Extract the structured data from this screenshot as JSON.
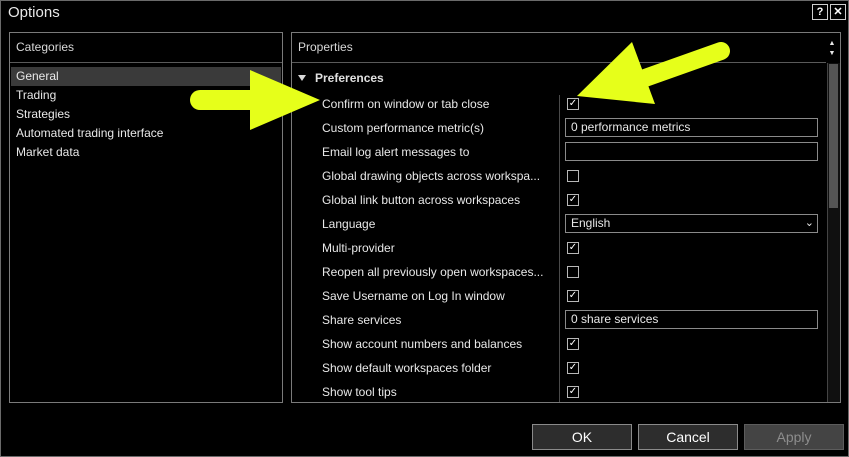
{
  "window": {
    "title": "Options",
    "help_label": "?",
    "close_label": "✕"
  },
  "categories": {
    "header": "Categories",
    "items": [
      "General",
      "Trading",
      "Strategies",
      "Automated trading interface",
      "Market data"
    ],
    "selected": "General"
  },
  "properties": {
    "header": "Properties",
    "group": "Preferences",
    "rows": [
      {
        "label": "Confirm on window or tab close",
        "type": "checkbox",
        "checked": true
      },
      {
        "label": "Custom performance metric(s)",
        "type": "field",
        "value": "0 performance metrics"
      },
      {
        "label": "Email log alert messages to",
        "type": "field",
        "value": ""
      },
      {
        "label": "Global drawing objects across workspa...",
        "type": "checkbox",
        "checked": false
      },
      {
        "label": "Global link button across workspaces",
        "type": "checkbox",
        "checked": true
      },
      {
        "label": "Language",
        "type": "select",
        "value": "English"
      },
      {
        "label": "Multi-provider",
        "type": "checkbox",
        "checked": true
      },
      {
        "label": "Reopen all previously open workspaces...",
        "type": "checkbox",
        "checked": false
      },
      {
        "label": "Save Username on Log In window",
        "type": "checkbox",
        "checked": true
      },
      {
        "label": "Share services",
        "type": "field",
        "value": "0 share services"
      },
      {
        "label": "Show account numbers and balances",
        "type": "checkbox",
        "checked": true
      },
      {
        "label": "Show default workspaces folder",
        "type": "checkbox",
        "checked": true
      },
      {
        "label": "Show tool tips",
        "type": "checkbox",
        "checked": true
      }
    ]
  },
  "buttons": {
    "ok": "OK",
    "cancel": "Cancel",
    "apply": "Apply"
  },
  "icons": {
    "checkmark": "check-icon",
    "dropdown": "chevron-down-icon",
    "expander": "triangle-down-icon"
  },
  "colors": {
    "background": "#000000",
    "border": "#7a7a7a",
    "annotation": "#e6ff1a"
  }
}
